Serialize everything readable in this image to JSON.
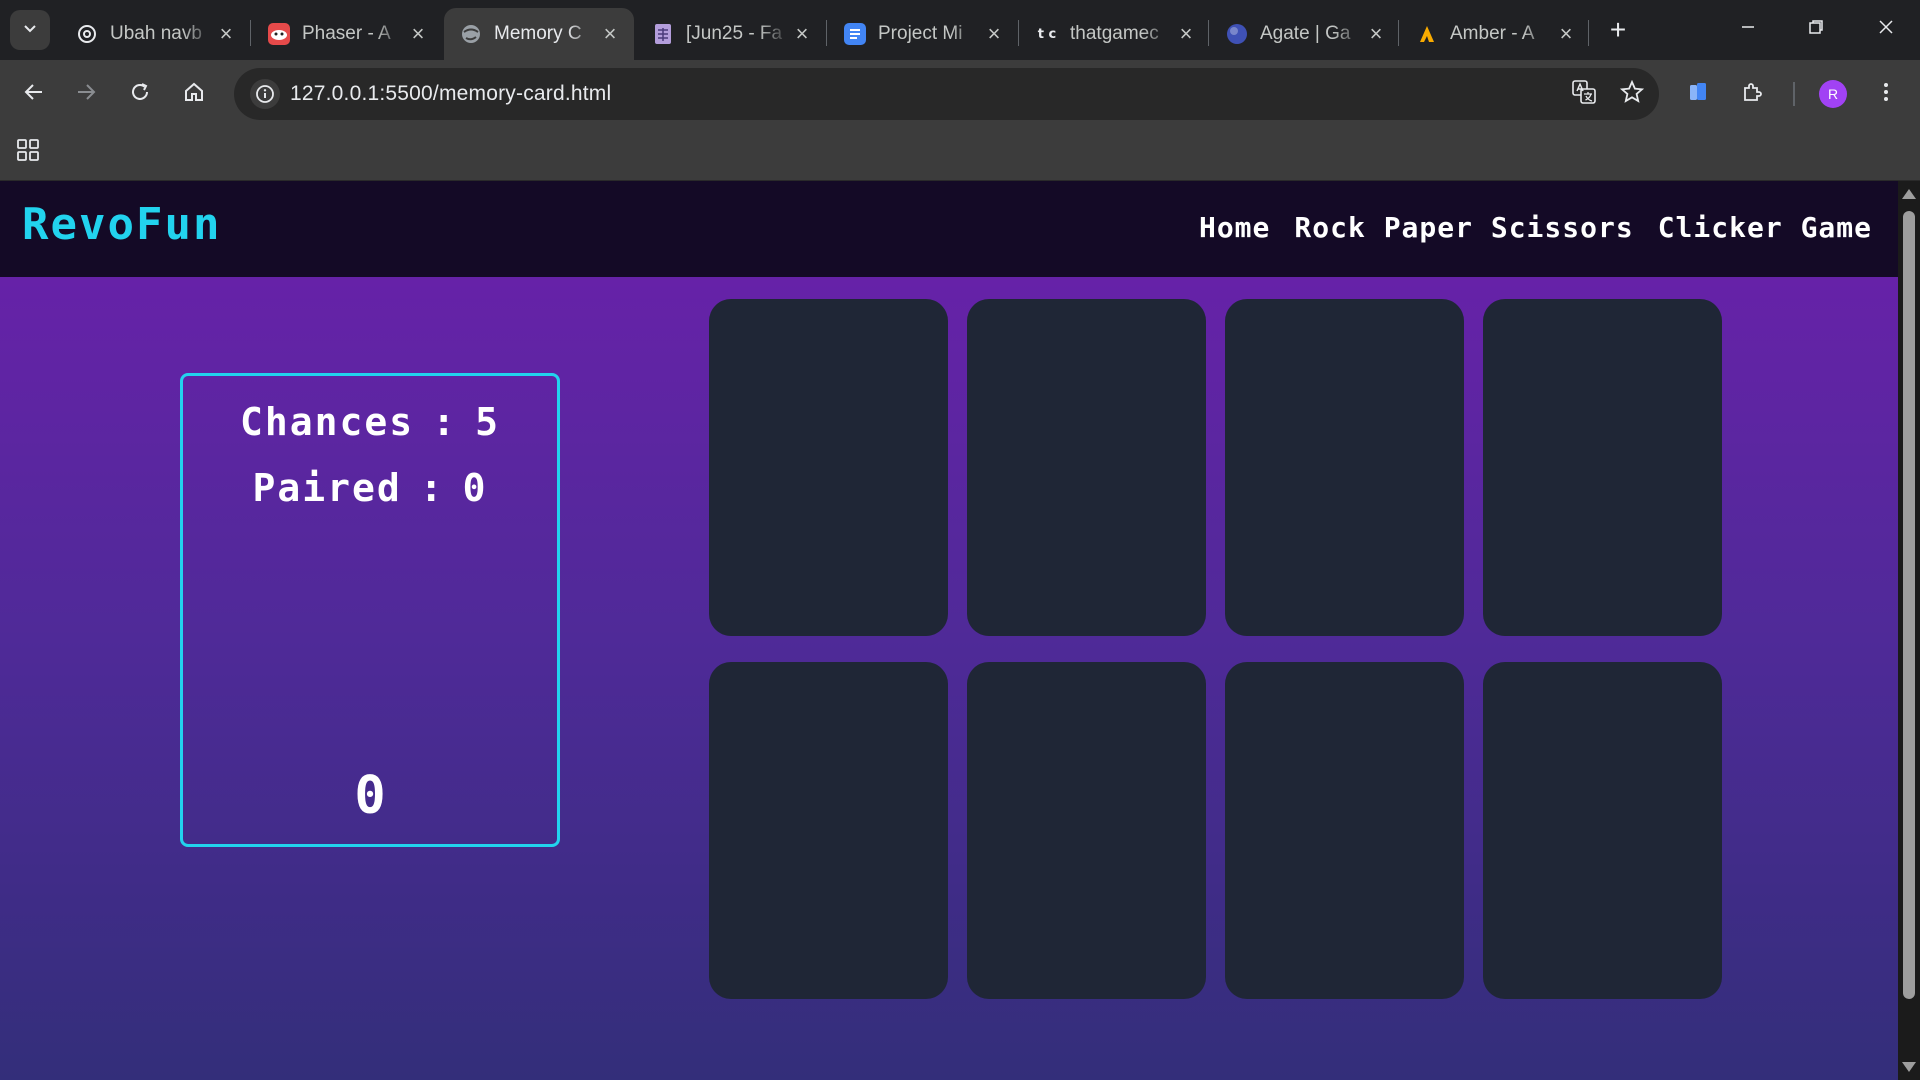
{
  "browser": {
    "tabs": [
      {
        "title": "Ubah navb",
        "icon": "openai-icon",
        "active": false
      },
      {
        "title": "Phaser - A",
        "icon": "phaser-icon",
        "active": false
      },
      {
        "title": "Memory C",
        "icon": "globe-icon",
        "active": true
      },
      {
        "title": "[Jun25 - Fa",
        "icon": "sheet-icon",
        "active": false
      },
      {
        "title": "Project Mi",
        "icon": "docs-icon",
        "active": false
      },
      {
        "title": "thatgamec",
        "icon": "tc-icon",
        "active": false
      },
      {
        "title": "Agate | Ga",
        "icon": "agate-icon",
        "active": false
      },
      {
        "title": "Amber - A",
        "icon": "amber-icon",
        "active": false
      }
    ],
    "tc_favicon_text": "t c",
    "url": "127.0.0.1:5500/memory-card.html",
    "profile_initial": "R",
    "accent_color": "#a142f4"
  },
  "site": {
    "brand": "RevoFun",
    "brand_color": "#22d3ee",
    "nav": [
      "Home",
      "Rock Paper Scissors",
      "Clicker Game"
    ]
  },
  "stats": {
    "chances_label": "Chances",
    "chances_value": "5",
    "paired_label": "Paired",
    "paired_value": "0",
    "separator": ":",
    "timer": "0"
  },
  "cards": {
    "count": 8,
    "face_down_color": "#1f2636"
  }
}
